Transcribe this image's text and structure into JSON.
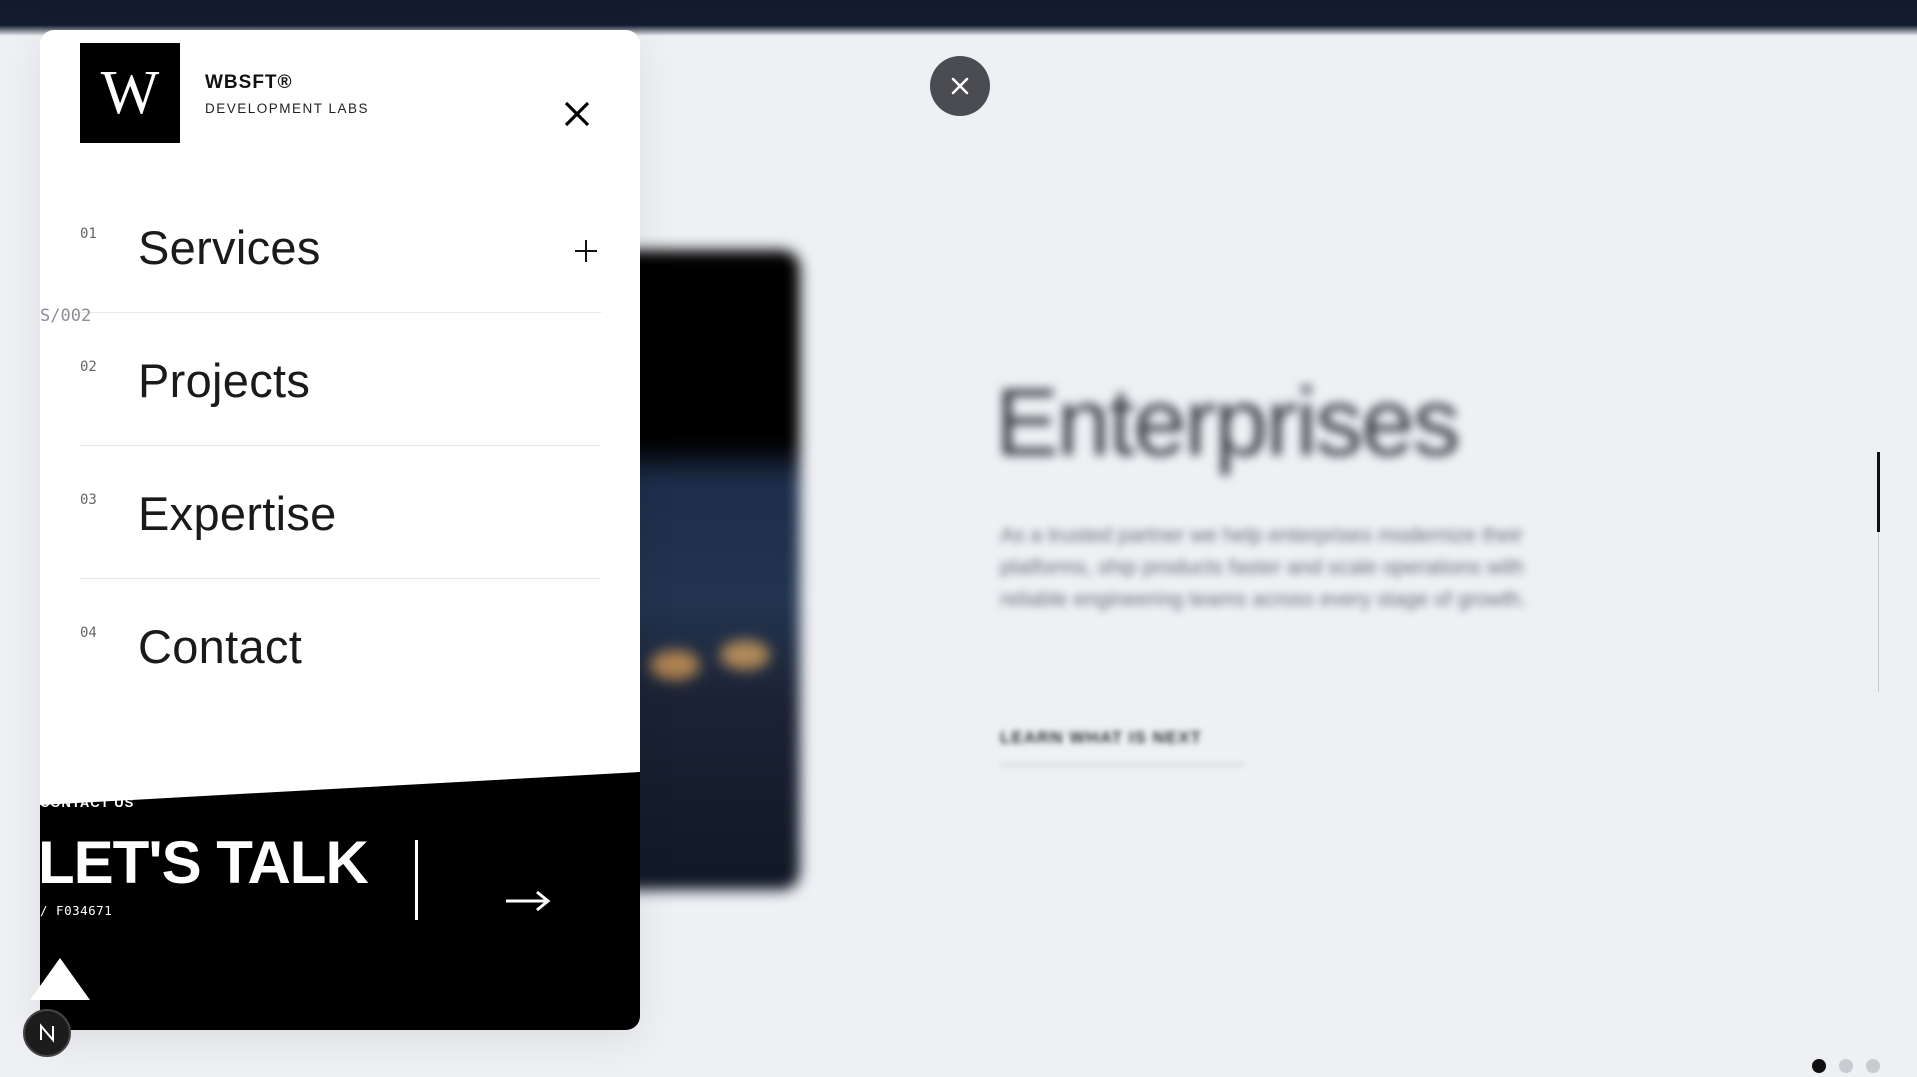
{
  "background": {
    "heading": "Enterprises",
    "paragraph": "As a trusted partner we help enterprises modernize their platforms, ship products faster and scale operations with reliable engineering teams across every stage of growth.",
    "link_label": "LEARN WHAT IS NEXT",
    "side_label": "S/002",
    "pager": {
      "total": 3,
      "active": 1
    }
  },
  "overlay_close_icon": "close-icon",
  "menu_panel": {
    "logo_letter": "W",
    "brand_name": "WBSFT®",
    "brand_sub": "DEVELOPMENT LABS",
    "close_icon": "close-icon",
    "items": [
      {
        "num": "01",
        "label": "Services",
        "expandable": true
      },
      {
        "num": "02",
        "label": "Projects",
        "expandable": false
      },
      {
        "num": "03",
        "label": "Expertise",
        "expandable": false
      },
      {
        "num": "04",
        "label": "Contact",
        "expandable": false
      }
    ],
    "cta": {
      "small": "CONTACT US",
      "big": "LET'S TALK",
      "code": "/ F034671",
      "arrow_icon": "arrow-right-icon"
    }
  },
  "badge_letter": "N",
  "colors": {
    "panel": "#ffffff",
    "cta": "#000000",
    "page_bg": "#eef0f4"
  }
}
